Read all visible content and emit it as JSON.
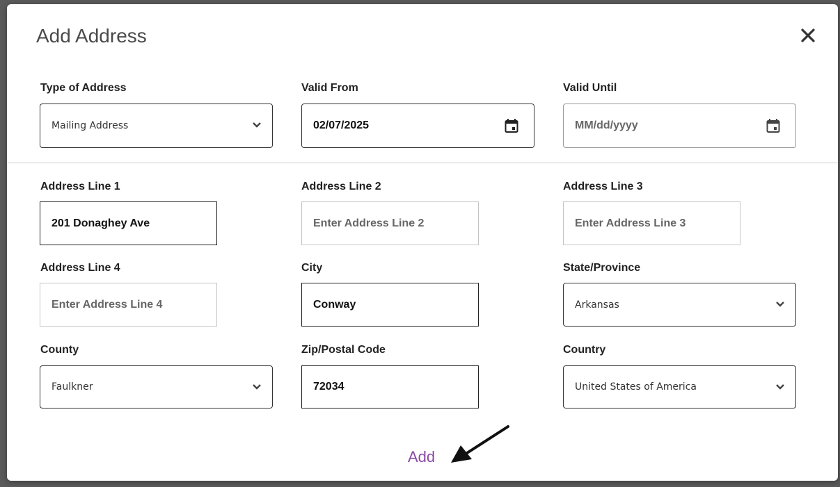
{
  "modal": {
    "title": "Add Address",
    "add_label": "Add"
  },
  "fields": {
    "type_of_address": {
      "label": "Type of Address",
      "value": "Mailing Address"
    },
    "valid_from": {
      "label": "Valid From",
      "value": "02/07/2025"
    },
    "valid_until": {
      "label": "Valid Until",
      "placeholder": "MM/dd/yyyy"
    },
    "address_line_1": {
      "label": "Address Line 1",
      "value": "201 Donaghey Ave"
    },
    "address_line_2": {
      "label": "Address Line 2",
      "placeholder": "Enter Address Line 2"
    },
    "address_line_3": {
      "label": "Address Line 3",
      "placeholder": "Enter Address Line 3"
    },
    "address_line_4": {
      "label": "Address Line 4",
      "placeholder": "Enter Address Line 4"
    },
    "city": {
      "label": "City",
      "value": "Conway"
    },
    "state": {
      "label": "State/Province",
      "value": "Arkansas"
    },
    "county": {
      "label": "County",
      "value": "Faulkner"
    },
    "zip": {
      "label": "Zip/Postal Code",
      "value": "72034"
    },
    "country": {
      "label": "Country",
      "value": "United States of America"
    }
  },
  "icons": {
    "close": "close-icon",
    "calendar": "calendar-icon",
    "dropdown": "chevron-down-icon",
    "annotation": "arrow-icon"
  },
  "colors": {
    "add_link": "#8a4aa6",
    "background_overlay": "#5a5a5a"
  }
}
